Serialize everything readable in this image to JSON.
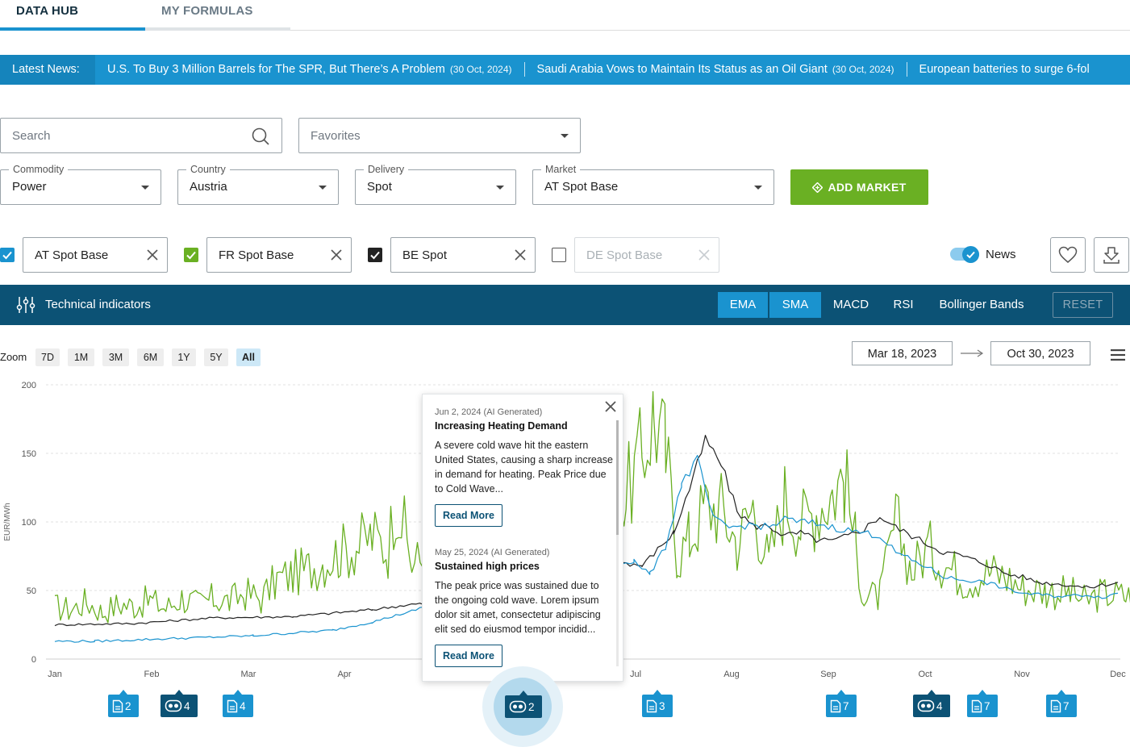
{
  "tabs": [
    {
      "label": "DATA HUB",
      "active": true
    },
    {
      "label": "MY FORMULAS",
      "active": false
    }
  ],
  "news_ticker": {
    "label": "Latest News:",
    "items": [
      {
        "headline": "U.S. To Buy 3 Million Barrels for The SPR, But There’s A Problem",
        "date": "(30 Oct, 2024)"
      },
      {
        "headline": "Saudi Arabia Vows to Maintain Its Status as an Oil Giant",
        "date": "(30 Oct, 2024)"
      },
      {
        "headline": "European batteries to surge 6-fol",
        "date": ""
      }
    ]
  },
  "search": {
    "placeholder": "Search"
  },
  "favorites": {
    "placeholder": "Favorites"
  },
  "filters": [
    {
      "label": "Commodity",
      "value": "Power"
    },
    {
      "label": "Country",
      "value": "Austria"
    },
    {
      "label": "Delivery",
      "value": "Spot"
    },
    {
      "label": "Market",
      "value": "AT Spot Base"
    }
  ],
  "add_market_label": "ADD MARKET",
  "markets": [
    {
      "name": "AT Spot Base",
      "checked": true,
      "color": "#1a93cf"
    },
    {
      "name": "FR Spot Base",
      "checked": true,
      "color": "#6ab023"
    },
    {
      "name": "BE Spot",
      "checked": true,
      "color": "#222222"
    },
    {
      "name": "DE Spot Base",
      "checked": false,
      "color": "#999999"
    }
  ],
  "news_toggle": {
    "label": "News",
    "on": true
  },
  "indicators": {
    "title": "Technical indicators",
    "buttons": [
      {
        "label": "EMA",
        "active": true
      },
      {
        "label": "SMA",
        "active": true
      },
      {
        "label": "MACD",
        "active": false
      },
      {
        "label": "RSI",
        "active": false
      },
      {
        "label": "Bollinger Bands",
        "active": false
      }
    ],
    "reset_label": "RESET"
  },
  "zoom": {
    "label": "Zoom",
    "options": [
      "7D",
      "1M",
      "3M",
      "6M",
      "1Y",
      "5Y",
      "All"
    ],
    "selected": "All"
  },
  "date_range": {
    "from": "Mar 18, 2023",
    "to": "Oct 30, 2023"
  },
  "colors": {
    "accent": "#1a93cf",
    "dark": "#0c5275",
    "green": "#6ab023",
    "black": "#222222"
  },
  "popup": {
    "items": [
      {
        "meta": "Jun 2, 2024 (AI Generated)",
        "title": "Increasing Heating Demand",
        "body": "A severe cold wave hit the eastern United States, causing a sharp increase in demand for heating. Peak Price due to Cold Wave...",
        "button": "Read More"
      },
      {
        "meta": "May 25, 2024 (AI Generated)",
        "title": "Sustained high prices",
        "body": "The peak price was sustained due to the ongoing cold wave. Lorem ipsum dolor sit amet, consectetur adipiscing elit sed do eiusmod tempor incidid...",
        "button": "Read More"
      }
    ]
  },
  "markers": [
    {
      "type": "news",
      "count": "2",
      "icon": "document-icon"
    },
    {
      "type": "ai",
      "count": "4",
      "icon": "robot-icon"
    },
    {
      "type": "news",
      "count": "4",
      "icon": "document-icon"
    },
    {
      "type": "ai",
      "count": "2",
      "icon": "robot-icon",
      "highlighted": true
    },
    {
      "type": "news",
      "count": "3",
      "icon": "document-icon"
    },
    {
      "type": "news",
      "count": "7",
      "icon": "document-icon"
    },
    {
      "type": "ai",
      "count": "4",
      "icon": "robot-icon"
    },
    {
      "type": "news",
      "count": "7",
      "icon": "document-icon"
    },
    {
      "type": "news",
      "count": "7",
      "icon": "document-icon"
    }
  ],
  "chart_data": {
    "type": "line",
    "ylabel": "EUR/MWh",
    "ylim": [
      0,
      200
    ],
    "yticks": [
      0,
      50,
      100,
      150,
      200
    ],
    "xticks": [
      "Jan",
      "Feb",
      "Mar",
      "Apr",
      "May",
      "Jun",
      "Jul",
      "Aug",
      "Sep",
      "Oct",
      "Nov",
      "Dec"
    ],
    "x_unit": "month index (0 = Jan, 11 = Dec)",
    "grid": true,
    "series": [
      {
        "name": "FR Spot Base",
        "color": "#6ab023",
        "points": [
          [
            0,
            38
          ],
          [
            0.2,
            36
          ],
          [
            0.4,
            42
          ],
          [
            0.6,
            34
          ],
          [
            0.8,
            40
          ],
          [
            1,
            39
          ],
          [
            1.2,
            43
          ],
          [
            1.4,
            37
          ],
          [
            1.6,
            45
          ],
          [
            1.8,
            40
          ],
          [
            2,
            44
          ],
          [
            2.2,
            42
          ],
          [
            2.4,
            48
          ],
          [
            2.6,
            44
          ],
          [
            2.8,
            58
          ],
          [
            3,
            62
          ],
          [
            3.2,
            66
          ],
          [
            3.4,
            72
          ],
          [
            3.6,
            78
          ],
          [
            3.8,
            82
          ],
          [
            4,
            90
          ],
          [
            4.2,
            80
          ],
          [
            4.3,
            120
          ],
          [
            4.5,
            70
          ],
          [
            4.9,
            75
          ],
          [
            5.2,
            70
          ],
          [
            5.5,
            66
          ],
          [
            6,
            62
          ],
          [
            6.2,
            58
          ],
          [
            6.4,
            40
          ],
          [
            6.6,
            58
          ],
          [
            6.8,
            82
          ],
          [
            7,
            110
          ],
          [
            7.2,
            120
          ],
          [
            7.4,
            148
          ],
          [
            7.55,
            182
          ],
          [
            7.7,
            150
          ],
          [
            7.85,
            75
          ],
          [
            8,
            88
          ],
          [
            8.2,
            112
          ],
          [
            8.4,
            110
          ],
          [
            8.6,
            85
          ],
          [
            8.8,
            112
          ],
          [
            9,
            70
          ],
          [
            9.2,
            118
          ],
          [
            9.4,
            98
          ],
          [
            9.6,
            110
          ],
          [
            9.8,
            122
          ],
          [
            9.95,
            134
          ],
          [
            10.1,
            82
          ],
          [
            10.2,
            45
          ],
          [
            10.4,
            46
          ],
          [
            10.6,
            100
          ],
          [
            10.8,
            64
          ],
          [
            11,
            82
          ],
          [
            11.2,
            70
          ],
          [
            11.5,
            58
          ],
          [
            11.8,
            64
          ],
          [
            12,
            60
          ],
          [
            12.2,
            52
          ],
          [
            12.5,
            50
          ],
          [
            12.8,
            48
          ],
          [
            13,
            42
          ],
          [
            13.2,
            48
          ],
          [
            13.5,
            46
          ],
          [
            13.8,
            44
          ],
          [
            14,
            48
          ]
        ]
      },
      {
        "name": "BE Spot",
        "color": "#222222",
        "points": [
          [
            0,
            25
          ],
          [
            1,
            26
          ],
          [
            2,
            30
          ],
          [
            3,
            31
          ],
          [
            4,
            36
          ],
          [
            4.5,
            40
          ],
          [
            5.5,
            40
          ],
          [
            6.2,
            52
          ],
          [
            6.5,
            64
          ],
          [
            7,
            72
          ],
          [
            7.4,
            68
          ],
          [
            7.6,
            80
          ],
          [
            7.8,
            92
          ],
          [
            8,
            124
          ],
          [
            8.2,
            160
          ],
          [
            8.4,
            142
          ],
          [
            8.6,
            108
          ],
          [
            8.8,
            97
          ],
          [
            9,
            97
          ],
          [
            9.2,
            90
          ],
          [
            9.4,
            92
          ],
          [
            9.6,
            87
          ],
          [
            9.8,
            86
          ],
          [
            10,
            90
          ],
          [
            10.2,
            95
          ],
          [
            10.4,
            104
          ],
          [
            10.6,
            96
          ],
          [
            10.8,
            90
          ],
          [
            11,
            84
          ],
          [
            11.2,
            78
          ],
          [
            11.4,
            76
          ],
          [
            11.6,
            72
          ],
          [
            11.8,
            68
          ],
          [
            12,
            62
          ],
          [
            12.2,
            60
          ],
          [
            12.4,
            56
          ],
          [
            12.6,
            55
          ],
          [
            12.8,
            54
          ],
          [
            13,
            52
          ],
          [
            13.2,
            54
          ],
          [
            13.4,
            56
          ]
        ]
      },
      {
        "name": "AT Spot Base",
        "color": "#1a93cf",
        "points": [
          [
            0,
            13
          ],
          [
            0.5,
            13
          ],
          [
            1,
            14
          ],
          [
            1.5,
            15
          ],
          [
            2,
            16
          ],
          [
            2.5,
            17
          ],
          [
            3,
            19
          ],
          [
            3.5,
            21
          ],
          [
            4,
            27
          ],
          [
            4.5,
            35
          ],
          [
            5,
            45
          ],
          [
            6.2,
            63
          ],
          [
            6.6,
            70
          ],
          [
            7,
            68
          ],
          [
            7.3,
            72
          ],
          [
            7.5,
            62
          ],
          [
            7.7,
            82
          ],
          [
            7.9,
            128
          ],
          [
            8.1,
            145
          ],
          [
            8.3,
            102
          ],
          [
            8.5,
            96
          ],
          [
            8.8,
            98
          ],
          [
            9,
            96
          ],
          [
            9.2,
            102
          ],
          [
            9.4,
            100
          ],
          [
            9.6,
            99
          ],
          [
            9.8,
            96
          ],
          [
            10,
            94
          ],
          [
            10.2,
            92
          ],
          [
            10.4,
            90
          ],
          [
            10.6,
            78
          ],
          [
            10.8,
            72
          ],
          [
            11,
            67
          ],
          [
            11.2,
            60
          ],
          [
            11.4,
            58
          ],
          [
            11.6,
            57
          ],
          [
            11.8,
            55
          ],
          [
            12,
            51
          ],
          [
            12.2,
            48
          ],
          [
            12.4,
            47
          ],
          [
            12.6,
            46
          ],
          [
            12.8,
            46
          ],
          [
            13,
            47
          ],
          [
            13.2,
            45
          ],
          [
            13.4,
            48
          ]
        ]
      }
    ]
  }
}
